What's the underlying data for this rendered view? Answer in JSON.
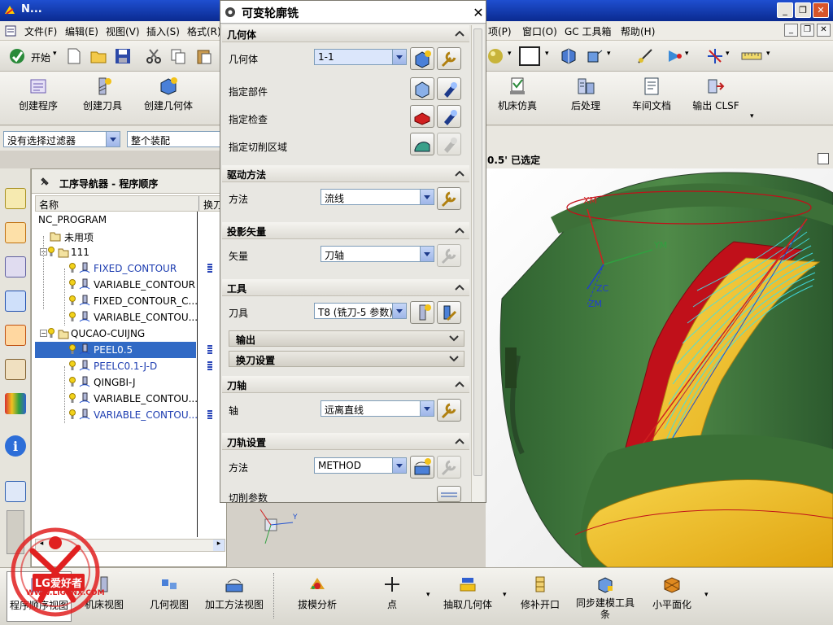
{
  "window": {
    "title": "N...",
    "minimize": "_",
    "restore": "❐",
    "close": "✕"
  },
  "menu": {
    "items": [
      "文件(F)",
      "编辑(E)",
      "视图(V)",
      "插入(S)",
      "格式(R)",
      "项(P)",
      "窗口(O)",
      "GC 工具箱",
      "帮助(H)"
    ]
  },
  "toolbar1": {
    "start_label": "开始"
  },
  "toolbar2": {
    "buttons": [
      "创建程序",
      "创建刀具",
      "创建几何体",
      "机床仿真",
      "后处理",
      "车间文档",
      "输出 CLSF"
    ]
  },
  "filter": {
    "selection_filter": "没有选择过滤器",
    "assembly": "整个装配"
  },
  "viewport": {
    "status": "0.5' 已选定",
    "axis_labels": {
      "xm": "XM",
      "ym": "YM",
      "zc": "ZC",
      "zm": "ZM"
    }
  },
  "navigator": {
    "title": "工序导航器 - 程序顺序",
    "columns": [
      "名称",
      "换刀"
    ],
    "rows": [
      {
        "label": "NC_PROGRAM",
        "kind": "root"
      },
      {
        "label": "未用项",
        "kind": "group"
      },
      {
        "label": "111",
        "kind": "program"
      },
      {
        "label": "FIXED_CONTOUR",
        "kind": "op",
        "blue": true
      },
      {
        "label": "VARIABLE_CONTOUR",
        "kind": "op",
        "blue": false
      },
      {
        "label": "FIXED_CONTOUR_C...",
        "kind": "op",
        "blue": false
      },
      {
        "label": "VARIABLE_CONTOU...",
        "kind": "op",
        "blue": false
      },
      {
        "label": "QUCAO-CUIJNG",
        "kind": "program"
      },
      {
        "label": "PEEL0.5",
        "kind": "op",
        "selected": true
      },
      {
        "label": "PEELC0.1-J-D",
        "kind": "op",
        "blue": true
      },
      {
        "label": "QINGBI-J",
        "kind": "op",
        "blue": false
      },
      {
        "label": "VARIABLE_CONTOU...",
        "kind": "op",
        "blue": false
      },
      {
        "label": "VARIABLE_CONTOU...",
        "kind": "op",
        "blue": true
      }
    ]
  },
  "dialog": {
    "title": "可变轮廓铣",
    "geometry": {
      "header": "几何体",
      "geom_label": "几何体",
      "geom_value": "1-1",
      "part_label": "指定部件",
      "check_label": "指定检查",
      "cut_label": "指定切削区域"
    },
    "drive": {
      "header": "驱动方法",
      "method_label": "方法",
      "method_value": "流线"
    },
    "projection": {
      "header": "投影矢量",
      "vector_label": "矢量",
      "vector_value": "刀轴"
    },
    "tool": {
      "header": "工具",
      "tool_label": "刀具",
      "tool_value": "T8 (铣刀-5 参数)",
      "output_label": "输出",
      "change_label": "换刀设置"
    },
    "axis": {
      "header": "刀轴",
      "axis_label": "轴",
      "axis_value": "远离直线"
    },
    "path": {
      "header": "刀轨设置",
      "method_label": "方法",
      "method_value": "METHOD",
      "cut_params_label": "切削参数"
    }
  },
  "bottombar": {
    "buttons": [
      "程序顺序视图",
      "机床视图",
      "几何视图",
      "加工方法视图",
      "拔模分析",
      "点",
      "抽取几何体",
      "修补开口",
      "同步建模工具条",
      "小平面化"
    ]
  },
  "logo": {
    "brand": "LG爱好者",
    "url": "WWW.LIGSNX.COM"
  },
  "colors": {
    "title_blue": "#0a2a90",
    "selection": "#316ac5",
    "part_green": "#3e7a3a",
    "part_yellow": "#f2c21a",
    "part_red": "#c0101a"
  }
}
